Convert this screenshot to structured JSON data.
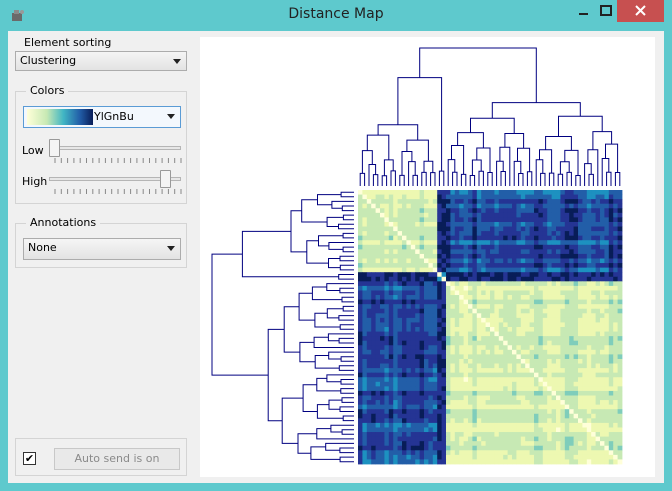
{
  "window": {
    "title": "Distance Map"
  },
  "sorting": {
    "group_title": "Element sorting",
    "selected": "Clustering"
  },
  "colors": {
    "group_title": "Colors",
    "palette": "YlGnBu",
    "low_label": "Low",
    "high_label": "High",
    "low_level": 0.0,
    "high_level": 0.92
  },
  "annotations": {
    "group_title": "Annotations",
    "selected": "None"
  },
  "auto_send": {
    "checked": true,
    "checkbox_glyph": "✔",
    "label": "Auto send is on"
  },
  "icons": [
    "app-icon",
    "minimize-icon",
    "maximize-icon",
    "close-icon",
    "chevron-down-icon",
    "check-icon"
  ],
  "accent_colors": {
    "titlebar": "#5ec9cd",
    "close": "#c75050",
    "dendrogram": "#000080"
  }
}
